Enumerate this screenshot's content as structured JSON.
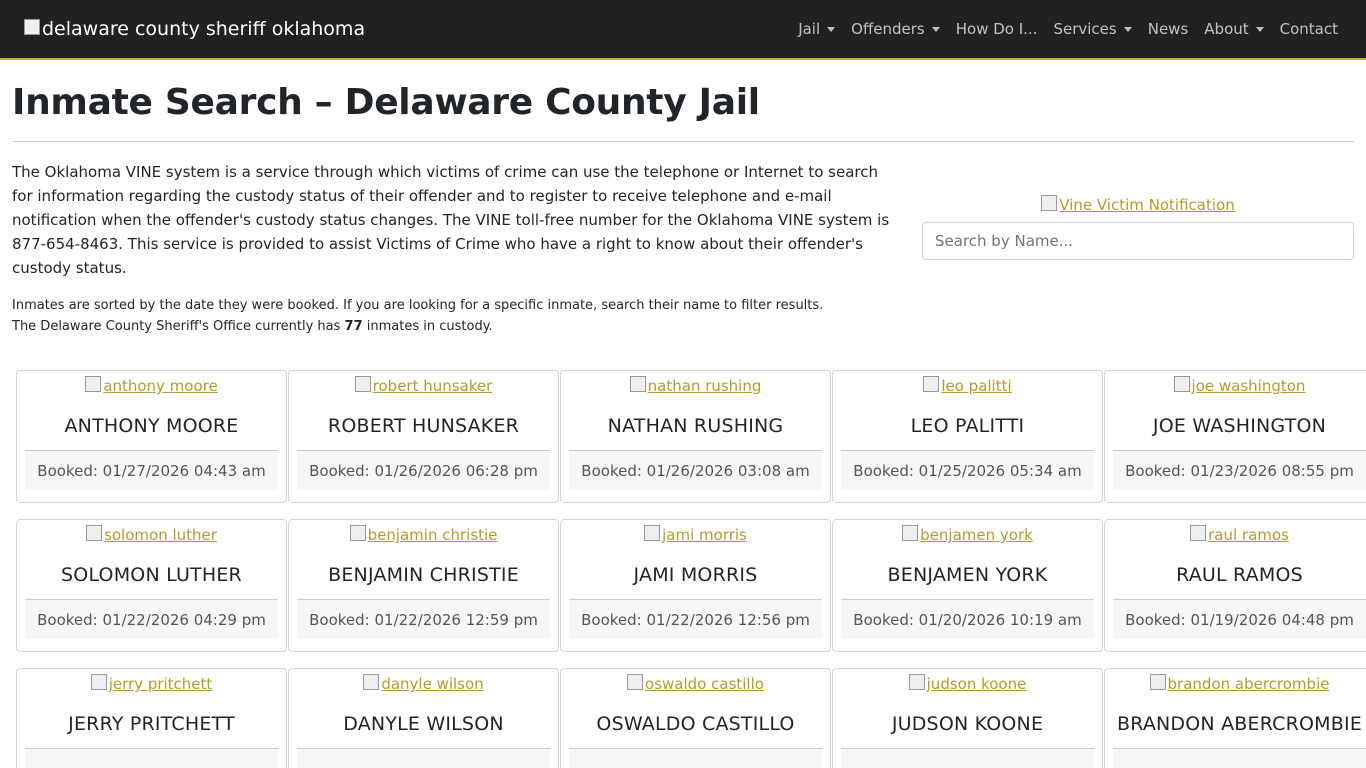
{
  "nav": {
    "brand_alt": "delaware county sheriff oklahoma",
    "items": [
      {
        "label": "Jail",
        "dropdown": true
      },
      {
        "label": "Offenders",
        "dropdown": true
      },
      {
        "label": "How Do I...",
        "dropdown": false
      },
      {
        "label": "Services",
        "dropdown": true
      },
      {
        "label": "News",
        "dropdown": false
      },
      {
        "label": "About",
        "dropdown": true
      },
      {
        "label": "Contact",
        "dropdown": false
      }
    ]
  },
  "page": {
    "title": "Inmate Search – Delaware County Jail",
    "intro": "The Oklahoma VINE system is a service through which victims of crime can use the telephone or Internet to search for information regarding the custody status of their offender and to register to receive telephone and e-mail notification when the offender's custody status changes. The VINE toll-free number for the Oklahoma VINE system is 877-654-8463. This service is provided to assist Victims of Crime who have a right to know about their offender's custody status.",
    "sort_note": "Inmates are sorted by the date they were booked. If you are looking for a specific inmate, search their name to filter results.",
    "count_prefix": "The Delaware County Sheriff's Office currently has",
    "count": "77",
    "count_suffix": "inmates in custody.",
    "vine_alt": "Vine Victim Notification",
    "search_placeholder": "Search by Name..."
  },
  "inmates": [
    {
      "img_alt": "anthony moore",
      "name": "ANTHONY MOORE",
      "booked": "Booked: 01/27/2026 04:43 am"
    },
    {
      "img_alt": "robert hunsaker",
      "name": "ROBERT HUNSAKER",
      "booked": "Booked: 01/26/2026 06:28 pm"
    },
    {
      "img_alt": "nathan rushing",
      "name": "NATHAN RUSHING",
      "booked": "Booked: 01/26/2026 03:08 am"
    },
    {
      "img_alt": "leo palitti",
      "name": "LEO PALITTI",
      "booked": "Booked: 01/25/2026 05:34 am"
    },
    {
      "img_alt": "joe washington",
      "name": "JOE WASHINGTON",
      "booked": "Booked: 01/23/2026 08:55 pm"
    },
    {
      "img_alt": "solomon luther",
      "name": "SOLOMON LUTHER",
      "booked": "Booked: 01/22/2026 04:29 pm"
    },
    {
      "img_alt": "benjamin christie",
      "name": "BENJAMIN CHRISTIE",
      "booked": "Booked: 01/22/2026 12:59 pm"
    },
    {
      "img_alt": "jami morris",
      "name": "JAMI MORRIS",
      "booked": "Booked: 01/22/2026 12:56 pm"
    },
    {
      "img_alt": "benjamen york",
      "name": "BENJAMEN YORK",
      "booked": "Booked: 01/20/2026 10:19 am"
    },
    {
      "img_alt": "raul ramos",
      "name": "RAUL RAMOS",
      "booked": "Booked: 01/19/2026 04:48 pm"
    },
    {
      "img_alt": "jerry pritchett",
      "name": "JERRY PRITCHETT",
      "booked": ""
    },
    {
      "img_alt": "danyle wilson",
      "name": "DANYLE WILSON",
      "booked": ""
    },
    {
      "img_alt": "oswaldo castillo",
      "name": "OSWALDO CASTILLO",
      "booked": ""
    },
    {
      "img_alt": "judson koone",
      "name": "JUDSON KOONE",
      "booked": ""
    },
    {
      "img_alt": "brandon abercrombie",
      "name": "BRANDON ABERCROMBIE",
      "booked": ""
    }
  ]
}
